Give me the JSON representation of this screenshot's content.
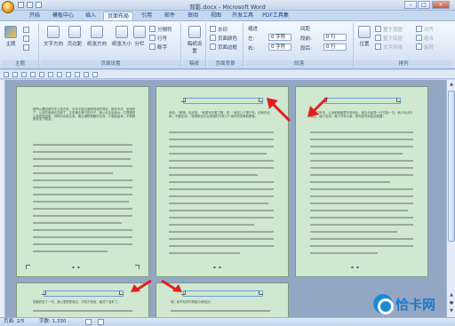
{
  "window": {
    "title": "背影.docx - Microsoft Word"
  },
  "tabs": [
    {
      "label": "开始"
    },
    {
      "label": "模板中心"
    },
    {
      "label": "插入"
    },
    {
      "label": "页面布局"
    },
    {
      "label": "引用"
    },
    {
      "label": "邮件"
    },
    {
      "label": "审阅"
    },
    {
      "label": "视图"
    },
    {
      "label": "开发工具"
    },
    {
      "label": "PDF工具集"
    }
  ],
  "active_tab": "页面布局",
  "ribbon": {
    "theme_group": {
      "label": "主题",
      "theme_btn": "主题"
    },
    "page_setup": {
      "label": "页面设置",
      "text_direction": "文字方向",
      "margins": "页边距",
      "orientation": "纸张方向",
      "size": "纸张大小",
      "columns": "分栏",
      "breaks": "分隔符",
      "line_numbers": "行号",
      "hyphenation": "断字"
    },
    "draft": {
      "label": "稿纸",
      "btn": "稿纸设置"
    },
    "background": {
      "label": "页面背景",
      "watermark": "水印",
      "page_color": "页面颜色",
      "page_border": "页面边框"
    },
    "paragraph": {
      "label": "段落",
      "indent": "缩进",
      "spacing": "间距",
      "left_label": "左:",
      "left_value": "0 字符",
      "right_label": "右:",
      "right_value": "0 字符",
      "before_label": "段前:",
      "before_value": "0 行",
      "after_label": "段后:",
      "after_value": "0 行"
    },
    "arrange": {
      "label": "排列",
      "position": "位置",
      "bring_front": "置于顶层",
      "send_back": "置于底层",
      "wrap": "文字环绕",
      "align": "对齐",
      "group": "组合",
      "rotate": "旋转"
    }
  },
  "pages": {
    "page1_text": "和所以要回家时在父亲去世，年多不能见面他祝我的背影。那年冬天，祖母死了，父亲的差使也交卸了，正是祸不单行的日子。我从北京到徐州，打算跟着父亲奔丧回家。到徐州见着父亲，看见满院狼藉的东西，又想起祖母，不禁簌簌地流下眼泪。",
    "page2_text": "我说：“爸爸，你走吧。”他望车外看了看，说：“我买几个橘子去。你就在此地，不要走动。”我看那边月台的栅栏外有几个卖东西的等着顾客。",
    "page3_text": "我近几年来，父亲和我都是东奔西走，家中光景是一日不如一日。他少年出外谋生，独力支持，做了许多大事。那知老境却如此颓唐！",
    "page4_text": "他最终说了一句，我心里很是难过，不知不觉地，竟流下泪来了。",
    "page5_text": "唉！我不知何时再能与他相见！"
  },
  "status": {
    "page": "页面: 2/5",
    "words": "字数: 1,330",
    "zoom": "71%"
  },
  "watermark": {
    "text": "恰卡网"
  },
  "colors": {
    "page_bg": "#cfe8cf",
    "arrow": "#e02020",
    "ribbon_tab": "#15428b"
  }
}
